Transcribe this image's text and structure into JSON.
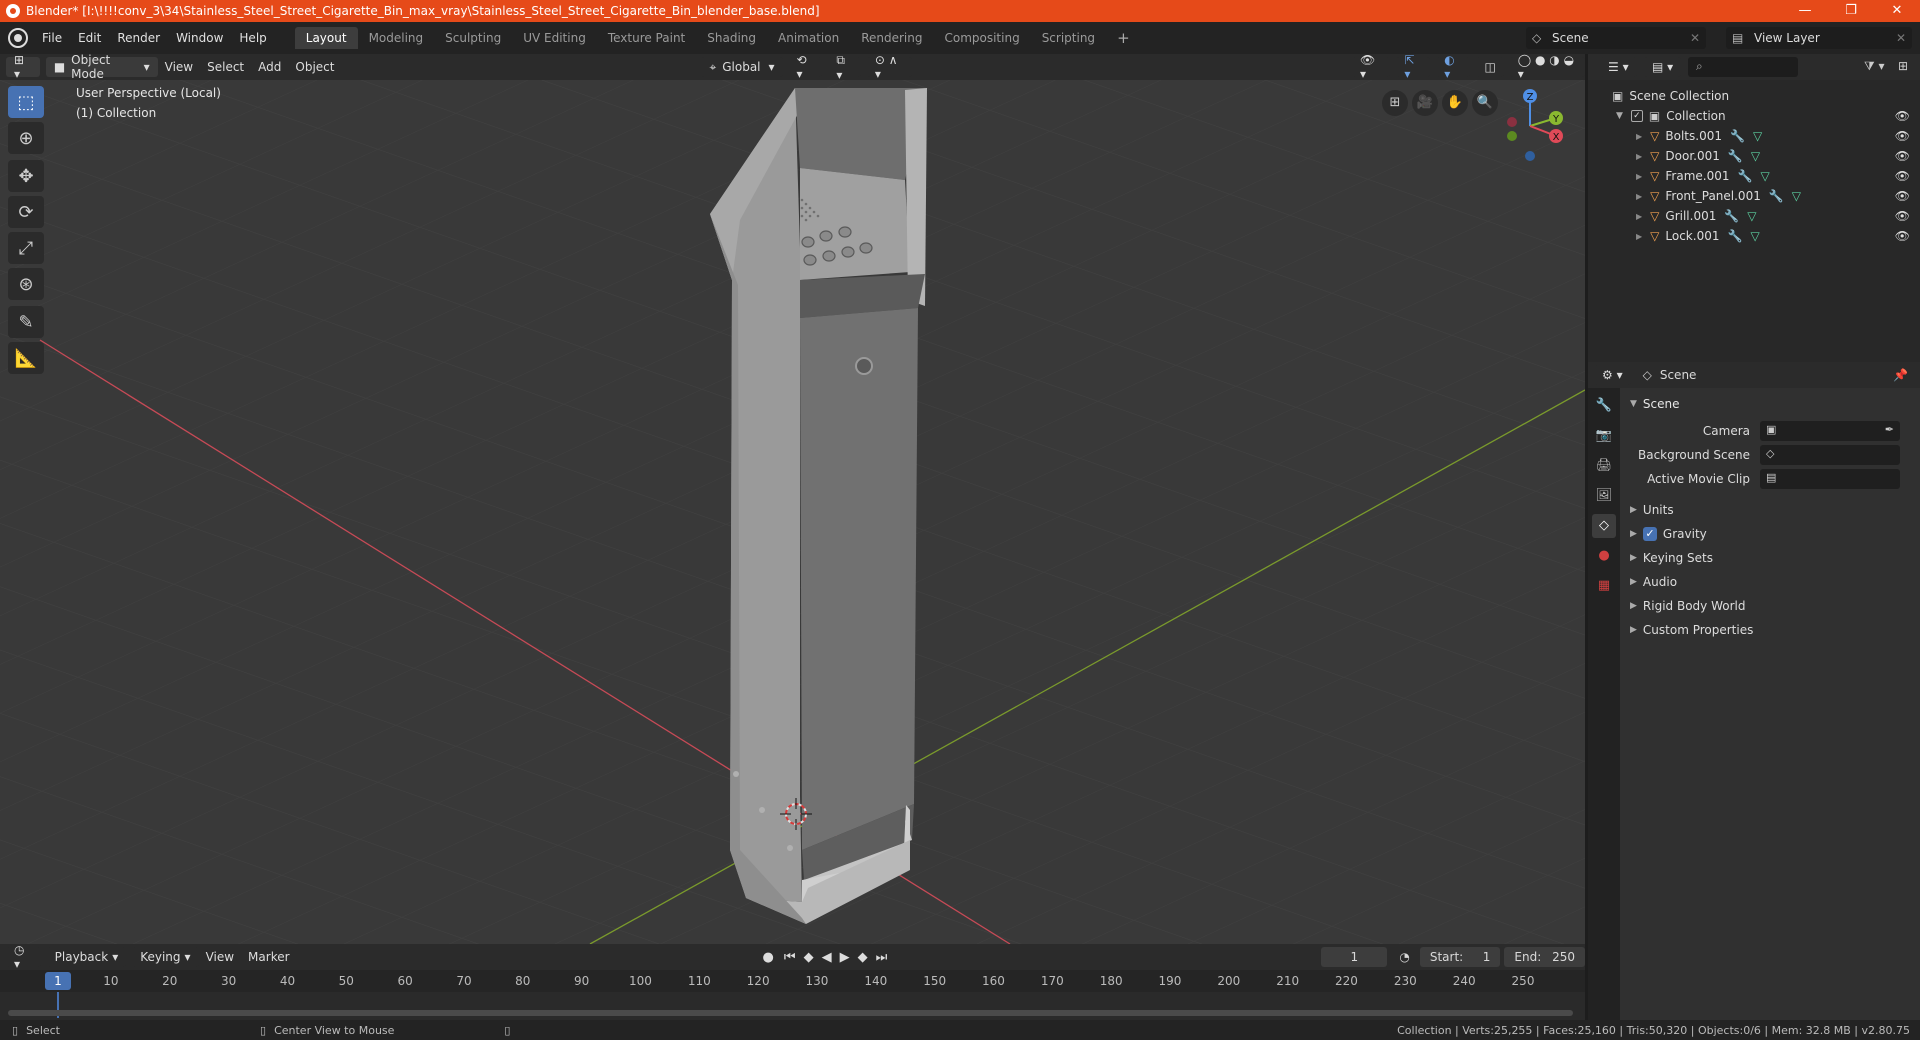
{
  "window": {
    "title": "Blender* [I:\\!!!!conv_3\\34\\Stainless_Steel_Street_Cigarette_Bin_max_vray\\Stainless_Steel_Street_Cigarette_Bin_blender_base.blend]",
    "minimize": "—",
    "maximize": "❐",
    "close": "✕"
  },
  "menu": [
    "File",
    "Edit",
    "Render",
    "Window",
    "Help"
  ],
  "workspaces": [
    "Layout",
    "Modeling",
    "Sculpting",
    "UV Editing",
    "Texture Paint",
    "Shading",
    "Animation",
    "Rendering",
    "Compositing",
    "Scripting"
  ],
  "workspace_add": "+",
  "scene_name": "Scene",
  "view_layer_name": "View Layer",
  "viewport_header": {
    "mode": "Object Mode",
    "menus": [
      "View",
      "Select",
      "Add",
      "Object"
    ],
    "orientation": "Global"
  },
  "viewport": {
    "perspective": "User Perspective (Local)",
    "collection": "(1) Collection",
    "gizmo": {
      "z": "Z",
      "y": "Y",
      "x": "X"
    }
  },
  "tools": [
    "select-box",
    "cursor",
    "move",
    "rotate",
    "scale",
    "transform",
    "annotate",
    "measure"
  ],
  "outliner": {
    "root": "Scene Collection",
    "collection": "Collection",
    "objects": [
      "Bolts.001",
      "Door.001",
      "Frame.001",
      "Front_Panel.001",
      "Grill.001",
      "Lock.001"
    ]
  },
  "properties": {
    "context": "Scene",
    "panel": "Scene",
    "camera_label": "Camera",
    "bg_scene_label": "Background Scene",
    "movie_clip_label": "Active Movie Clip",
    "collapsed": [
      "Units",
      "Gravity",
      "Keying Sets",
      "Audio",
      "Rigid Body World",
      "Custom Properties"
    ],
    "gravity_checked": true
  },
  "timeline": {
    "menus": [
      "Playback",
      "Keying",
      "View",
      "Marker"
    ],
    "current_frame": "1",
    "start_label": "Start:",
    "start": "1",
    "end_label": "End:",
    "end": "250",
    "ticks": [
      "1",
      "10",
      "20",
      "30",
      "40",
      "50",
      "60",
      "70",
      "80",
      "90",
      "100",
      "110",
      "120",
      "130",
      "140",
      "150",
      "160",
      "170",
      "180",
      "190",
      "200",
      "210",
      "220",
      "230",
      "240",
      "250"
    ]
  },
  "status": {
    "left1": "Select",
    "left2": "Center View to Mouse",
    "right": "Collection | Verts:25,255 | Faces:25,160 | Tris:50,320 | Objects:0/6 | Mem: 32.8 MB | v2.80.75"
  },
  "colors": {
    "title_bar": "#e64a19",
    "accent": "#4772b3",
    "x_axis": "#e04a58",
    "y_axis": "#8ab830",
    "z_axis": "#4f8fe6"
  }
}
